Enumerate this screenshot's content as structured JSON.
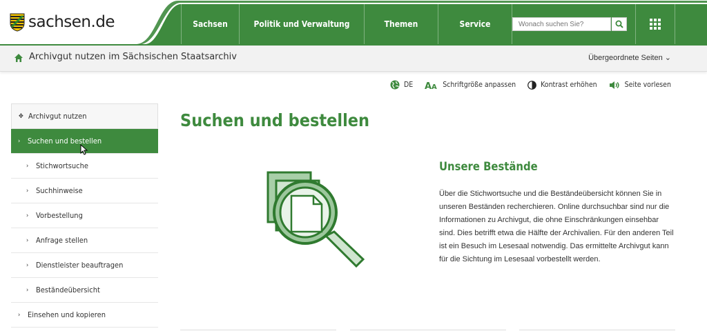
{
  "site": {
    "logo_text": "sachsen.de",
    "green": "#3e8a3e",
    "nav": [
      "Sachsen",
      "Politik und Verwaltung",
      "Themen",
      "Service"
    ],
    "search_placeholder": "Wonach suchen Sie?",
    "icons": {
      "search": "search-icon",
      "grid": "grid-icon"
    }
  },
  "breadcrumb": {
    "title": "Archivgut nutzen im Sächsischen Staatsarchiv",
    "parent_pages": "Übergeordnete Seiten ⌄"
  },
  "tools": {
    "language": "DE",
    "font_size": "Schriftgröße anpassen",
    "contrast": "Kontrast erhöhen",
    "read_aloud": "Seite vorlesen"
  },
  "sidebar": {
    "items": [
      {
        "label": "Archivgut nutzen",
        "level": 0,
        "state": "parent"
      },
      {
        "label": "Suchen und bestellen",
        "level": 0,
        "state": "active"
      },
      {
        "label": "Stichwortsuche",
        "level": 1,
        "state": "normal"
      },
      {
        "label": "Suchhinweise",
        "level": 1,
        "state": "normal"
      },
      {
        "label": "Vorbestellung",
        "level": 1,
        "state": "normal"
      },
      {
        "label": "Anfrage stellen",
        "level": 1,
        "state": "normal"
      },
      {
        "label": "Dienstleister beauftragen",
        "level": 1,
        "state": "normal"
      },
      {
        "label": "Beständeübersicht",
        "level": 1,
        "state": "normal"
      },
      {
        "label": "Einsehen und kopieren",
        "level": 0,
        "state": "normal"
      }
    ]
  },
  "main": {
    "title": "Suchen und bestellen",
    "section_title": "Unsere Bestände",
    "section_text": "Über die Stichwortsuche und die Beständeübersicht können Sie in unseren Beständen recherchieren. Online durchsuchbar sind nur die Informationen zu Archivgut, die ohne Einschränkungen einsehbar sind. Dies betrifft etwa die Hälfte der Archivalien. Für den anderen Teil ist ein Besuch im Lesesaal notwendig. Das ermittelte Archivgut kann für die Sichtung im Lesesaal vorbestellt werden."
  }
}
